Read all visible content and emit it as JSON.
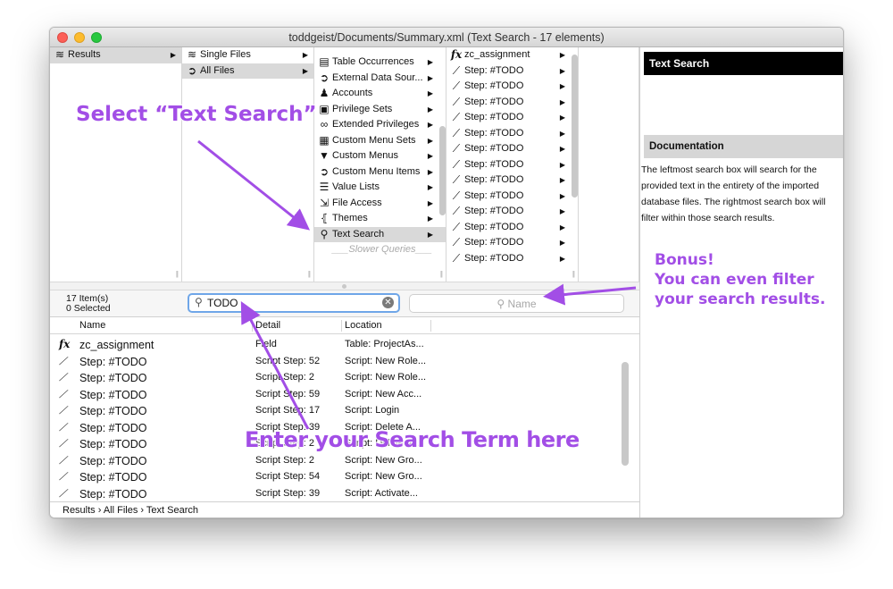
{
  "window": {
    "title": "toddgeist/Documents/Summary.xml  (Text Search - 17 elements)"
  },
  "browser": {
    "col1": [
      {
        "icon": "layers-icon",
        "glyph": "≋",
        "label": "Results",
        "selected": true
      }
    ],
    "col2": [
      {
        "icon": "layers-icon",
        "glyph": "≋",
        "label": "Single Files",
        "selected": false
      },
      {
        "icon": "circle-arrow-icon",
        "glyph": "➲",
        "label": "All Files",
        "selected": true
      }
    ],
    "col3": [
      {
        "icon": "table-icon",
        "glyph": "▤",
        "label": "Table Occurrences"
      },
      {
        "icon": "circle-arrow-icon",
        "glyph": "➲",
        "label": "External Data Sour..."
      },
      {
        "icon": "person-icon",
        "glyph": "♟",
        "label": "Accounts"
      },
      {
        "icon": "lock-icon",
        "glyph": "▣",
        "label": "Privilege Sets"
      },
      {
        "icon": "rings-icon",
        "glyph": "∞",
        "label": "Extended Privileges"
      },
      {
        "icon": "menu-table-icon",
        "glyph": "▦",
        "label": "Custom Menu Sets"
      },
      {
        "icon": "triangle-down-icon",
        "glyph": "▼",
        "label": "Custom Menus"
      },
      {
        "icon": "circle-arrow-icon",
        "glyph": "➲",
        "label": "Custom Menu Items"
      },
      {
        "icon": "list-icon",
        "glyph": "☰",
        "label": "Value Lists"
      },
      {
        "icon": "file-arrow-icon",
        "glyph": "⇲",
        "label": "File Access"
      },
      {
        "icon": "braces-icon",
        "glyph": "⦃",
        "label": "Themes"
      },
      {
        "icon": "magnifier-icon",
        "glyph": "⚲",
        "label": "Text Search",
        "selected": true
      },
      {
        "icon": "",
        "glyph": "",
        "label": "___Slower Queries___",
        "dim": true
      }
    ],
    "col4": [
      {
        "icon": "function-icon",
        "glyph": "fx",
        "label": "zc_assignment"
      },
      {
        "icon": "script-step-icon",
        "glyph": "⟋",
        "label": "Step: #TODO"
      },
      {
        "icon": "script-step-icon",
        "glyph": "⟋",
        "label": "Step: #TODO"
      },
      {
        "icon": "script-step-icon",
        "glyph": "⟋",
        "label": "Step: #TODO"
      },
      {
        "icon": "script-step-icon",
        "glyph": "⟋",
        "label": "Step: #TODO"
      },
      {
        "icon": "script-step-icon",
        "glyph": "⟋",
        "label": "Step: #TODO"
      },
      {
        "icon": "script-step-icon",
        "glyph": "⟋",
        "label": "Step: #TODO"
      },
      {
        "icon": "script-step-icon",
        "glyph": "⟋",
        "label": "Step: #TODO"
      },
      {
        "icon": "script-step-icon",
        "glyph": "⟋",
        "label": "Step: #TODO"
      },
      {
        "icon": "script-step-icon",
        "glyph": "⟋",
        "label": "Step: #TODO"
      },
      {
        "icon": "script-step-icon",
        "glyph": "⟋",
        "label": "Step: #TODO"
      },
      {
        "icon": "script-step-icon",
        "glyph": "⟋",
        "label": "Step: #TODO"
      },
      {
        "icon": "script-step-icon",
        "glyph": "⟋",
        "label": "Step: #TODO"
      },
      {
        "icon": "script-step-icon",
        "glyph": "⟋",
        "label": "Step: #TODO"
      }
    ]
  },
  "searchbar": {
    "count_line1": "17 Item(s)",
    "count_line2": "0 Selected",
    "search_value": "TODO",
    "filter_placeholder": "Name"
  },
  "results": {
    "columns": [
      "Name",
      "Detail",
      "Location"
    ],
    "rows": [
      {
        "icon": "function-icon",
        "glyph": "fx",
        "name": "zc_assignment",
        "detail": "Field",
        "location": "Table: ProjectAs..."
      },
      {
        "icon": "script-step-icon",
        "glyph": "⟋",
        "name": "Step: #TODO",
        "detail": "Script Step: 52",
        "location": "Script: New Role..."
      },
      {
        "icon": "script-step-icon",
        "glyph": "⟋",
        "name": "Step: #TODO",
        "detail": "Script Step: 2",
        "location": "Script: New Role..."
      },
      {
        "icon": "script-step-icon",
        "glyph": "⟋",
        "name": "Step: #TODO",
        "detail": "Script Step: 59",
        "location": "Script: New Acc..."
      },
      {
        "icon": "script-step-icon",
        "glyph": "⟋",
        "name": "Step: #TODO",
        "detail": "Script Step: 17",
        "location": "Script: Login"
      },
      {
        "icon": "script-step-icon",
        "glyph": "⟋",
        "name": "Step: #TODO",
        "detail": "Script Step: 39",
        "location": "Script: Delete A..."
      },
      {
        "icon": "script-step-icon",
        "glyph": "⟋",
        "name": "Step: #TODO",
        "detail": "Script Step: 2",
        "location": "Script: Delete A..."
      },
      {
        "icon": "script-step-icon",
        "glyph": "⟋",
        "name": "Step: #TODO",
        "detail": "Script Step: 2",
        "location": "Script: New Gro..."
      },
      {
        "icon": "script-step-icon",
        "glyph": "⟋",
        "name": "Step: #TODO",
        "detail": "Script Step: 54",
        "location": "Script: New Gro..."
      },
      {
        "icon": "script-step-icon",
        "glyph": "⟋",
        "name": "Step: #TODO",
        "detail": "Script Step: 39",
        "location": "Script: Activate..."
      }
    ]
  },
  "statusbar": {
    "path": "Results  ›  All Files  ›  Text Search"
  },
  "doc": {
    "title": "Text Search",
    "heading": "Documentation",
    "body": "The leftmost search box will search for the provided text in the entirety of the imported database files. The rightmost search box will filter within those search results."
  },
  "annotations": {
    "select": "Select “Text Search”",
    "enter": "Enter your Search Term here",
    "bonus_line1": "Bonus!",
    "bonus_line2": "You can even filter",
    "bonus_line3": "your search results."
  },
  "colors": {
    "annotation": "#a24ee6",
    "accent_focus": "#6fa6e8",
    "selection": "#d9d9d9"
  }
}
